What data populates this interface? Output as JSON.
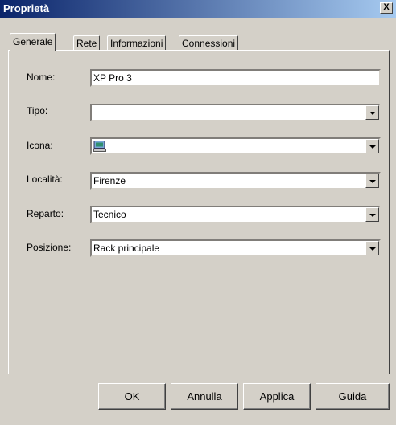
{
  "window": {
    "title": "Proprietà",
    "close_glyph": "X"
  },
  "tabs": [
    {
      "label": "Generale",
      "active": true
    },
    {
      "label": "Rete",
      "active": false
    },
    {
      "label": "Informazioni",
      "active": false
    },
    {
      "label": "Connessioni",
      "active": false
    }
  ],
  "form": {
    "nome": {
      "label": "Nome:",
      "value": "XP Pro 3"
    },
    "tipo": {
      "label": "Tipo:",
      "value": ""
    },
    "icona": {
      "label": "Icona:",
      "icon": "computer-icon"
    },
    "localita": {
      "label": "Località:",
      "value": "Firenze"
    },
    "reparto": {
      "label": "Reparto:",
      "value": "Tecnico"
    },
    "posizione": {
      "label": "Posizione:",
      "value": "Rack principale"
    }
  },
  "buttons": {
    "ok": "OK",
    "annulla": "Annulla",
    "applica": "Applica",
    "guida": "Guida"
  }
}
